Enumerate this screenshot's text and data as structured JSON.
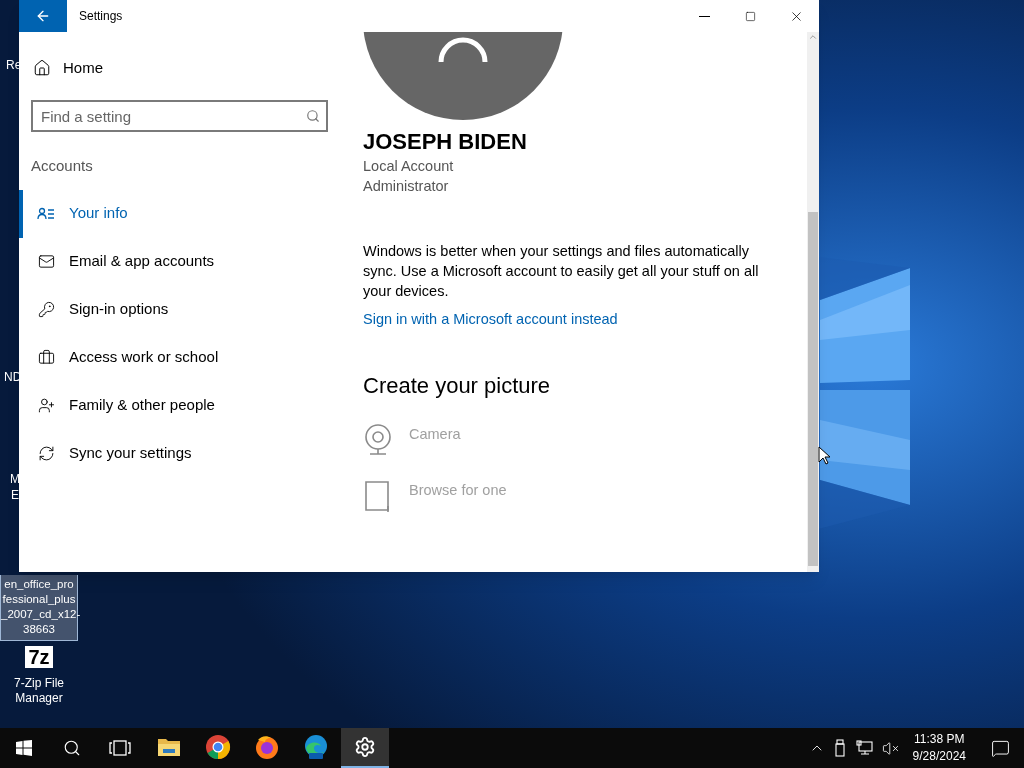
{
  "desktop": {
    "partial_labels": [
      "Re",
      "ND",
      "M",
      "E"
    ],
    "icons": [
      {
        "kind": "file",
        "label": "en_office_pro fessional_plus _2007_cd_x12- 38663",
        "selected": true
      },
      {
        "kind": "sevenzip",
        "glyph": "7z",
        "label": "7-Zip File Manager",
        "selected": false
      }
    ]
  },
  "window": {
    "title": "Settings",
    "sidebar": {
      "home": "Home",
      "search": {
        "placeholder": "Find a setting"
      },
      "section": "Accounts",
      "items": [
        {
          "kind": "info",
          "label": "Your info",
          "selected": true
        },
        {
          "kind": "mail",
          "label": "Email & app accounts",
          "selected": false
        },
        {
          "kind": "key",
          "label": "Sign-in options",
          "selected": false
        },
        {
          "kind": "work",
          "label": "Access work or school",
          "selected": false
        },
        {
          "kind": "family",
          "label": "Family & other people",
          "selected": false
        },
        {
          "kind": "sync",
          "label": "Sync your settings",
          "selected": false
        }
      ]
    },
    "content": {
      "name": "JOSEPH BIDEN",
      "account_lines": [
        "Local Account",
        "Administrator"
      ],
      "sync_text": "Windows is better when your settings and files automatically sync. Use a Microsoft account to easily get all your stuff on all your devices.",
      "link": "Sign in with a Microsoft account instead",
      "picture_heading": "Create your picture",
      "picture_options": [
        {
          "kind": "camera",
          "label": "Camera",
          "disabled": true
        },
        {
          "kind": "browse",
          "label": "Browse for one",
          "disabled": true
        }
      ]
    }
  },
  "taskbar": {
    "apps": [
      {
        "kind": "explorer",
        "active": false
      },
      {
        "kind": "chrome",
        "active": false
      },
      {
        "kind": "firefox",
        "active": false
      },
      {
        "kind": "edge",
        "active": false
      },
      {
        "kind": "settings",
        "active": true
      }
    ],
    "time": "11:38 PM",
    "date": "9/28/2024"
  }
}
